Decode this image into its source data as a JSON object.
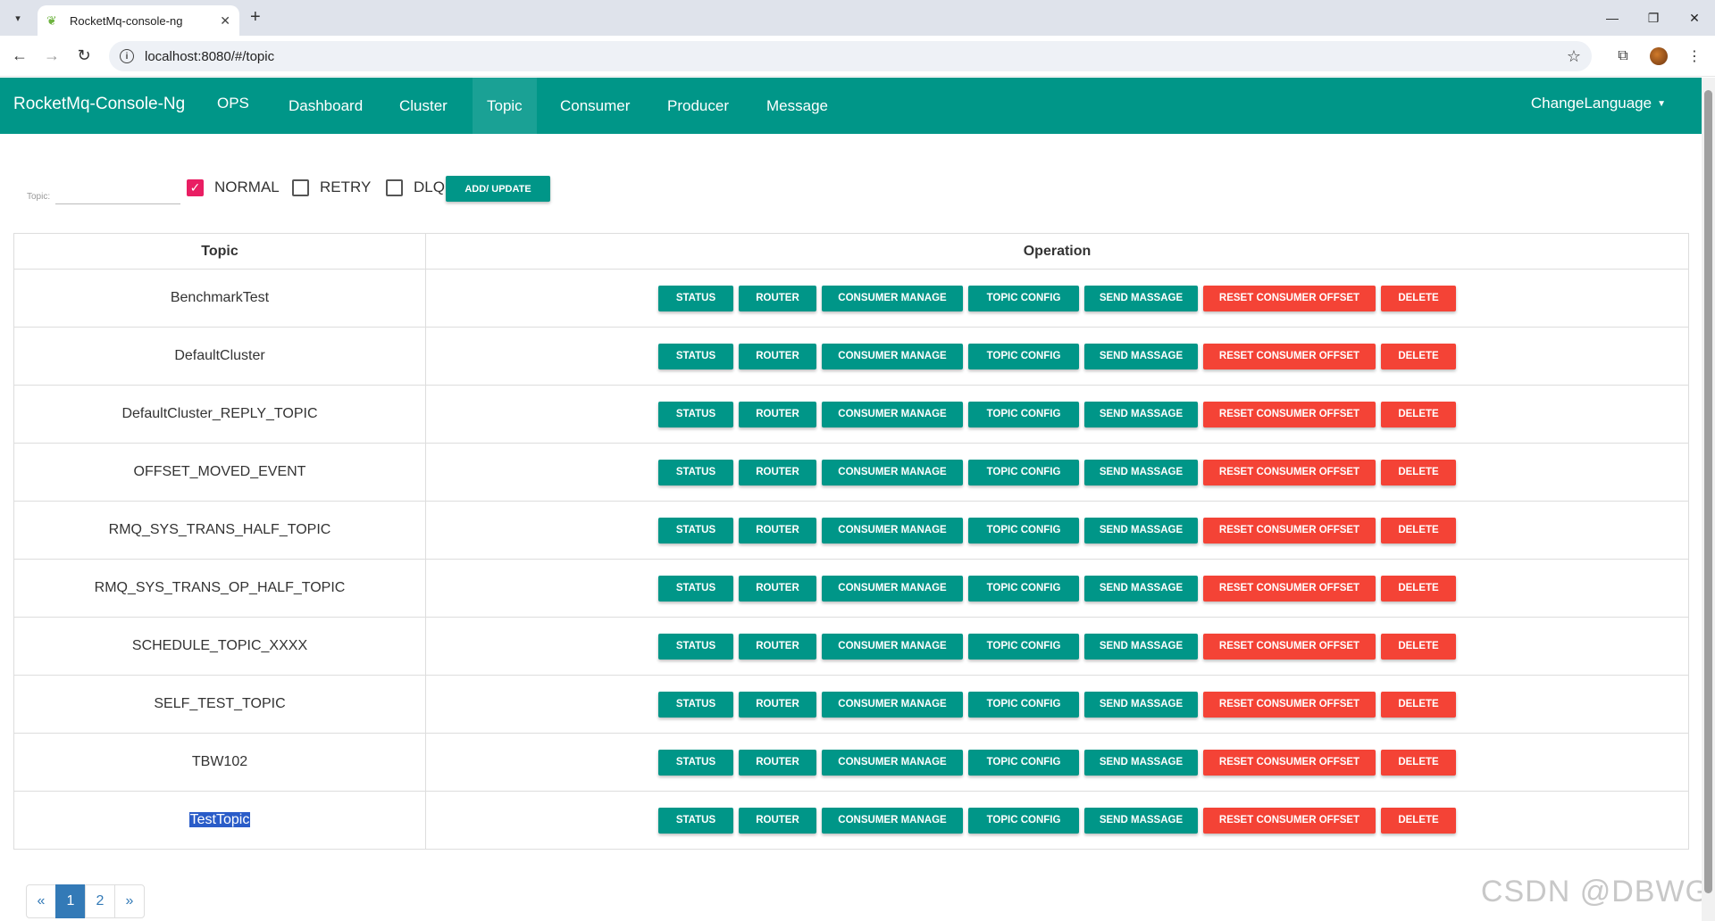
{
  "browser": {
    "tab_title": "RocketMq-console-ng",
    "url": "localhost:8080/#/topic",
    "new_tab": "+",
    "tab_close": "✕"
  },
  "navbar": {
    "brand": "RocketMq-Console-Ng",
    "items": [
      "OPS",
      "Dashboard",
      "Cluster",
      "Topic",
      "Consumer",
      "Producer",
      "Message"
    ],
    "active": "Topic",
    "change_language": "ChangeLanguage"
  },
  "filters": {
    "topic_label": "Topic:",
    "topic_value": "",
    "normal": {
      "label": "NORMAL",
      "checked": true
    },
    "retry": {
      "label": "RETRY",
      "checked": false
    },
    "dlq": {
      "label": "DLQ",
      "checked": false
    },
    "add_update": "ADD/ UPDATE"
  },
  "table": {
    "headers": {
      "topic": "Topic",
      "operation": "Operation"
    },
    "operations": {
      "status": "STATUS",
      "router": "ROUTER",
      "consumer_manage": "CONSUMER MANAGE",
      "topic_config": "TOPIC CONFIG",
      "send_massage": "SEND MASSAGE",
      "reset_consumer_offset": "RESET CONSUMER OFFSET",
      "delete": "DELETE"
    },
    "rows": [
      "BenchmarkTest",
      "DefaultCluster",
      "DefaultCluster_REPLY_TOPIC",
      "OFFSET_MOVED_EVENT",
      "RMQ_SYS_TRANS_HALF_TOPIC",
      "RMQ_SYS_TRANS_OP_HALF_TOPIC",
      "SCHEDULE_TOPIC_XXXX",
      "SELF_TEST_TOPIC",
      "TBW102",
      "TestTopic"
    ]
  },
  "pagination": {
    "prev": "«",
    "pages": [
      "1",
      "2"
    ],
    "current": "1",
    "next": "»"
  },
  "watermark": "CSDN @DBWG",
  "colors": {
    "primary": "#009688",
    "danger": "#f44336",
    "checkbox": "#e91e63",
    "pager_active": "#337ab7"
  }
}
